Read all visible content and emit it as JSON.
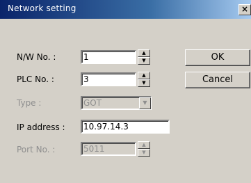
{
  "window": {
    "title": "Network setting",
    "close_glyph": "×"
  },
  "form": {
    "nw_no": {
      "label": "N/W No. :",
      "value": "1"
    },
    "plc_no": {
      "label": "PLC No. :",
      "value": "3"
    },
    "type": {
      "label": "Type :",
      "value": "GOT",
      "disabled": true
    },
    "ip_address": {
      "label": "IP address :",
      "value": "10.97.14.3"
    },
    "port_no": {
      "label": "Port No. :",
      "value": "5011",
      "disabled": true
    }
  },
  "buttons": {
    "ok": "OK",
    "cancel": "Cancel"
  },
  "colors": {
    "title_start": "#0a246a",
    "title_end": "#a6caf0",
    "dialog_bg": "#d4d0c8",
    "disabled_text": "#8f8f8f"
  }
}
